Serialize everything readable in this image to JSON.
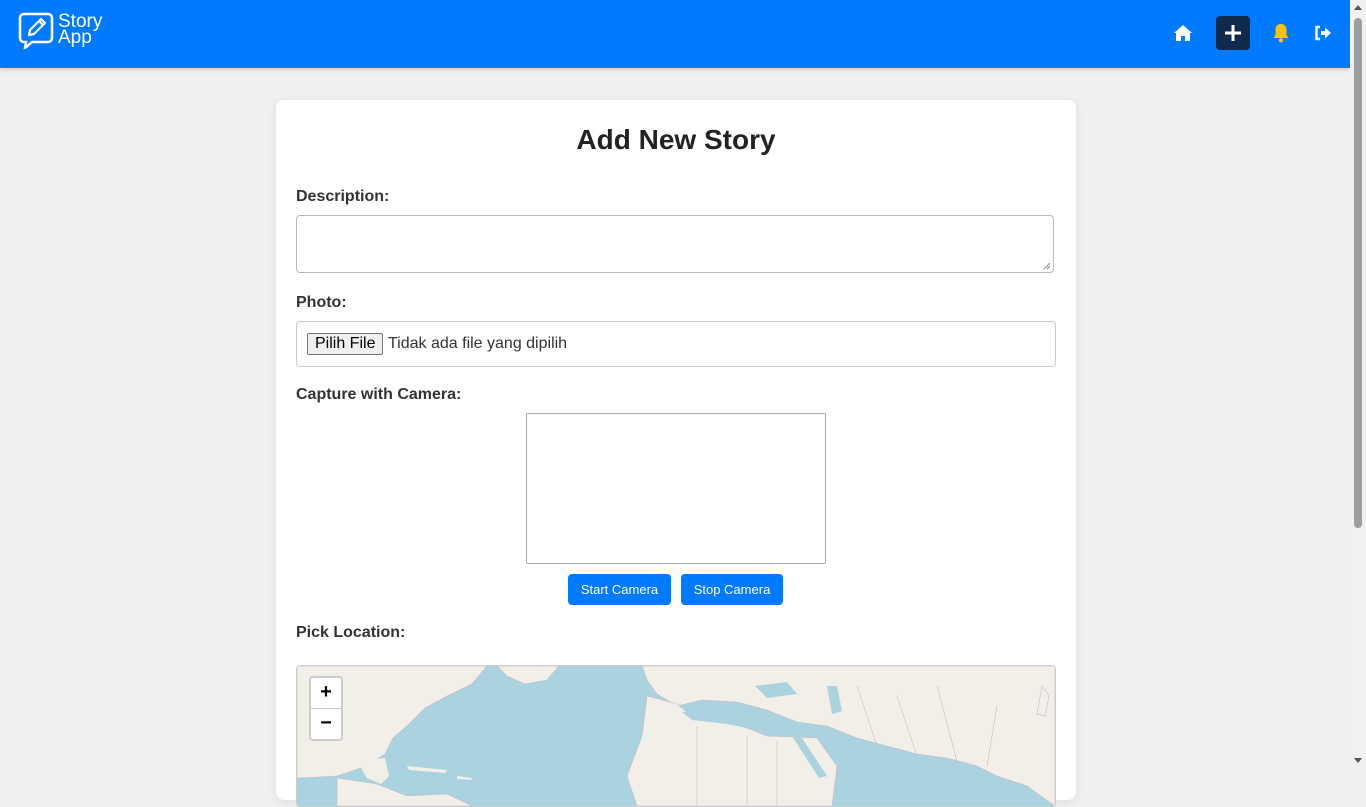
{
  "header": {
    "logo_line1": "Story",
    "logo_line2": "App",
    "brand_color": "#007bff",
    "nav": [
      {
        "icon": "home-icon"
      },
      {
        "icon": "plus-icon",
        "active": true
      },
      {
        "icon": "bell-icon"
      },
      {
        "icon": "logout-icon"
      }
    ]
  },
  "form": {
    "title": "Add New Story",
    "description_label": "Description:",
    "description_value": "",
    "photo_label": "Photo:",
    "file_button": "Pilih File",
    "file_status": "Tidak ada file yang dipilih",
    "camera_label": "Capture with Camera:",
    "start_camera": "Start Camera",
    "stop_camera": "Stop Camera",
    "location_label": "Pick Location:",
    "zoom_in": "+",
    "zoom_out": "−"
  }
}
